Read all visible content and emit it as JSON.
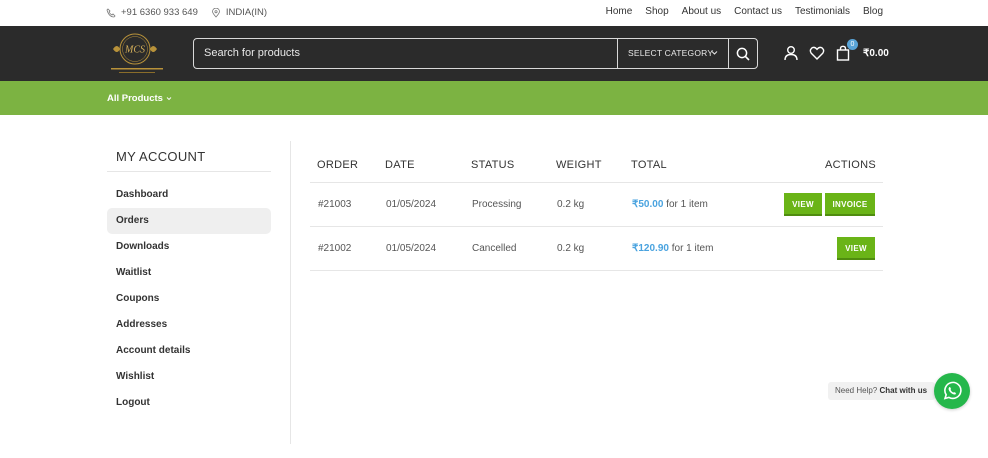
{
  "topbar": {
    "phone": "+91 6360 933 649",
    "region": "INDIA(IN)",
    "nav": [
      "Home",
      "Shop",
      "About us",
      "Contact us",
      "Testimonials",
      "Blog"
    ]
  },
  "header": {
    "logo_text": "MCS",
    "search_placeholder": "Search for products",
    "category_label": "SELECT CATEGORY",
    "cart_count": "0",
    "cart_total": "₹0.00"
  },
  "greenbar": {
    "all_products": "All Products"
  },
  "sidebar": {
    "title": "MY ACCOUNT",
    "items": [
      "Dashboard",
      "Orders",
      "Downloads",
      "Waitlist",
      "Coupons",
      "Addresses",
      "Account details",
      "Wishlist",
      "Logout"
    ],
    "active_index": 1
  },
  "orders": {
    "headers": [
      "ORDER",
      "DATE",
      "STATUS",
      "WEIGHT",
      "TOTAL",
      "ACTIONS"
    ],
    "rows": [
      {
        "order": "#21003",
        "date": "01/05/2024",
        "status": "Processing",
        "weight": "0.2 kg",
        "amount": "₹50.00",
        "items": "for 1 item",
        "actions": [
          "VIEW",
          "INVOICE"
        ]
      },
      {
        "order": "#21002",
        "date": "01/05/2024",
        "status": "Cancelled",
        "weight": "0.2 kg",
        "amount": "₹120.90",
        "items": "for 1 item",
        "actions": [
          "VIEW"
        ]
      }
    ]
  },
  "help": {
    "prefix": "Need Help?",
    "link": "Chat with us"
  },
  "colors": {
    "accent_green": "#7cb342",
    "button_green": "#6ab417",
    "header_dark": "#2b2b2b",
    "price_blue": "#4aa3df",
    "whatsapp": "#25b74b"
  }
}
